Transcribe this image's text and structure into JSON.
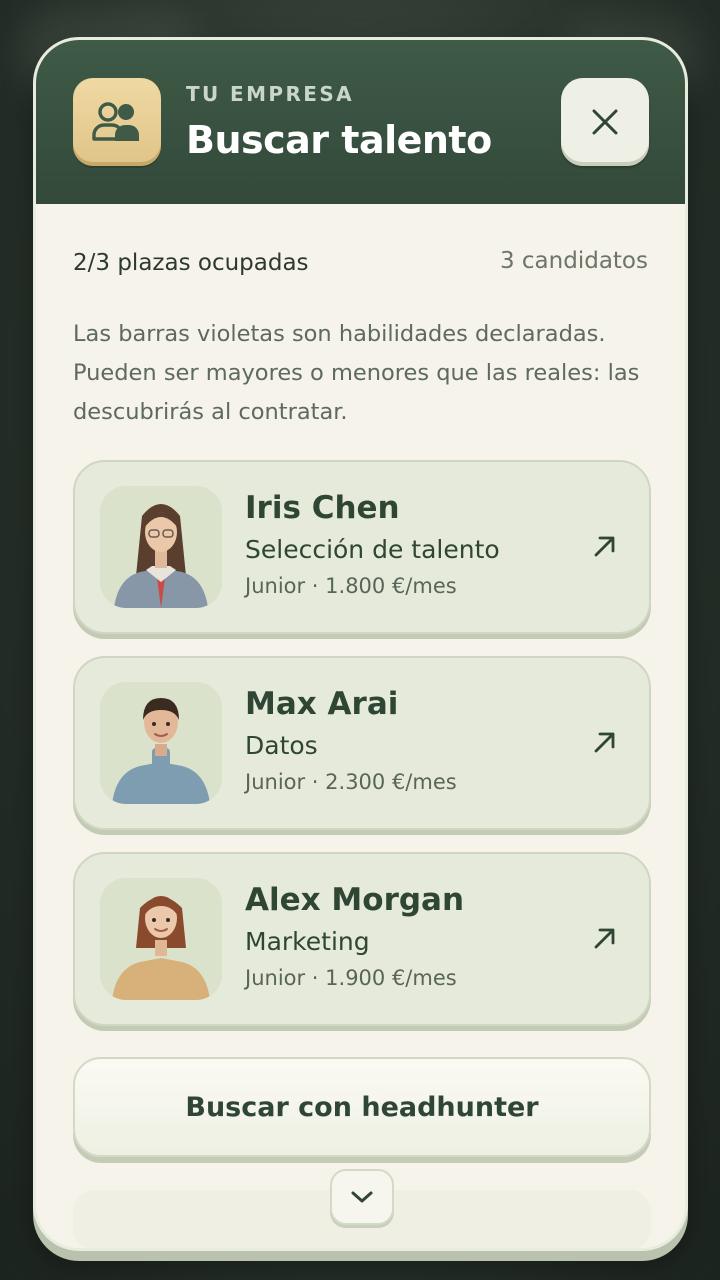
{
  "header": {
    "kicker": "TU EMPRESA",
    "title": "Buscar talento",
    "icon": "people-icon",
    "close_icon": "close-icon"
  },
  "stats": {
    "slots": "2/3 plazas ocupadas",
    "candidates": "3 candidatos"
  },
  "hint": "Las barras violetas son habilidades declaradas. Pueden ser mayores o menores que las reales: las descubrirás al contratar.",
  "candidates": [
    {
      "name": "Iris Chen",
      "role": "Selección de talento",
      "meta": "Junior · 1.800 €/mes"
    },
    {
      "name": "Max Arai",
      "role": "Datos",
      "meta": "Junior · 2.300 €/mes"
    },
    {
      "name": "Alex Morgan",
      "role": "Marketing",
      "meta": "Junior · 1.900 €/mes"
    }
  ],
  "actions": {
    "headhunter": "Buscar con headhunter"
  },
  "colors": {
    "header": "#3f5a47",
    "accent_gold": "#e0c488",
    "card": "#e6eadb",
    "text_dark": "#2f4634"
  }
}
